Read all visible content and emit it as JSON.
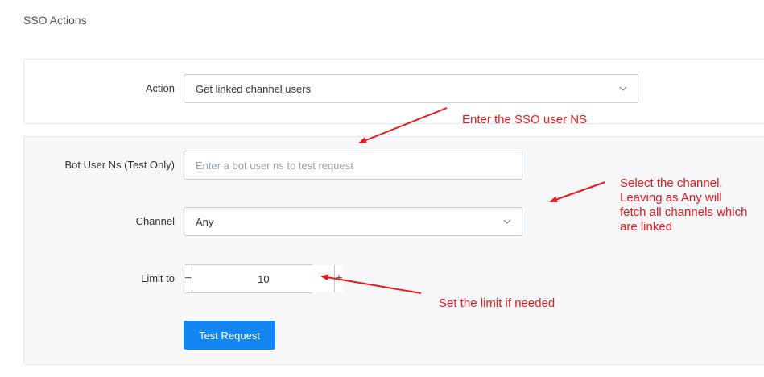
{
  "page": {
    "title": "SSO Actions"
  },
  "action": {
    "label": "Action",
    "selected": "Get linked channel users"
  },
  "bot_user_ns": {
    "label": "Bot User Ns (Test Only)",
    "placeholder": "Enter a bot user ns to test request",
    "value": ""
  },
  "channel": {
    "label": "Channel",
    "selected": "Any"
  },
  "limit": {
    "label": "Limit to",
    "value": "10",
    "minus": "−",
    "plus": "+"
  },
  "test_button": {
    "label": "Test Request"
  },
  "annotations": {
    "sso_user": "Enter the SSO user NS",
    "channel_line1": "Select the channel.",
    "channel_line2": "Leaving as Any will",
    "channel_line3": "fetch all channels which",
    "channel_line4": "are linked",
    "limit": "Set the limit if needed"
  },
  "colors": {
    "accent": "#1486f3",
    "annotation": "#e8191c",
    "panel_bg": "#f6f7f9"
  },
  "icons": {
    "select_caret": "chevron-down-icon",
    "decrement": "minus-icon",
    "increment": "plus-icon",
    "pointer": "arrow-icon"
  }
}
